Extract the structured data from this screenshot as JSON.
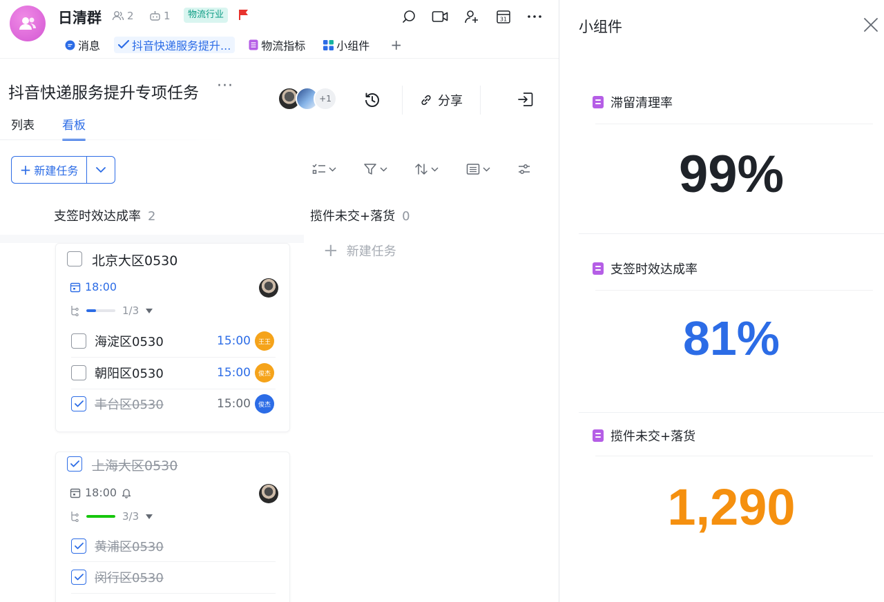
{
  "header": {
    "group_name": "日清群",
    "member_count": "2",
    "bot_count": "1",
    "industry_tag": "物流行业"
  },
  "chat_tabs": [
    {
      "label": "消息",
      "icon": "chat-bubble-icon"
    },
    {
      "label": "抖音快递服务提升...",
      "icon": "task-check-icon"
    },
    {
      "label": "物流指标",
      "icon": "doc-icon"
    },
    {
      "label": "小组件",
      "icon": "widget-grid-icon"
    }
  ],
  "project": {
    "title": "抖音快递服务提升专项任务",
    "more_members": "+1",
    "share_label": "分享",
    "views": [
      "列表",
      "看板"
    ],
    "new_task_label": "新建任务"
  },
  "columns": [
    {
      "title": "支签时效达成率",
      "count": "2"
    },
    {
      "title": "揽件未交+落货",
      "count": "0",
      "add_label": "新建任务"
    }
  ],
  "cards": [
    {
      "title": "北京大区0530",
      "done": false,
      "due": "18:00",
      "progress_text": "1/3",
      "progress": 0.33,
      "subtasks": [
        {
          "name": "海淀区0530",
          "time": "15:00",
          "done": false,
          "avatar": "王王",
          "avatar_color": "#f5a31a"
        },
        {
          "name": "朝阳区0530",
          "time": "15:00",
          "done": false,
          "avatar": "俊杰",
          "avatar_color": "#f5a31a"
        },
        {
          "name": "丰台区0530",
          "time": "15:00",
          "done": true,
          "avatar": "俊杰",
          "avatar_color": "#2c6ce6"
        }
      ]
    },
    {
      "title": "上海大区0530",
      "done": true,
      "due": "18:00",
      "progress_text": "3/3",
      "progress": 1.0,
      "subtasks": [
        {
          "name": "黄浦区0530",
          "done": true
        },
        {
          "name": "闵行区0530",
          "done": true
        }
      ]
    }
  ],
  "widgets_panel": {
    "title": "小组件",
    "widgets": [
      {
        "title": "滞留清理率",
        "value": "99%",
        "color": "#1f2329"
      },
      {
        "title": "支签时效达成率",
        "value": "81%",
        "color": "#2c6ce6"
      },
      {
        "title": "揽件未交+落货",
        "value": "1,290",
        "color": "#f5900f"
      }
    ]
  },
  "colors": {
    "accent": "#2c6ce6",
    "progress_blue": "#2c6ce6",
    "progress_green": "#16c60c",
    "group_avatar": "#d357d3"
  }
}
